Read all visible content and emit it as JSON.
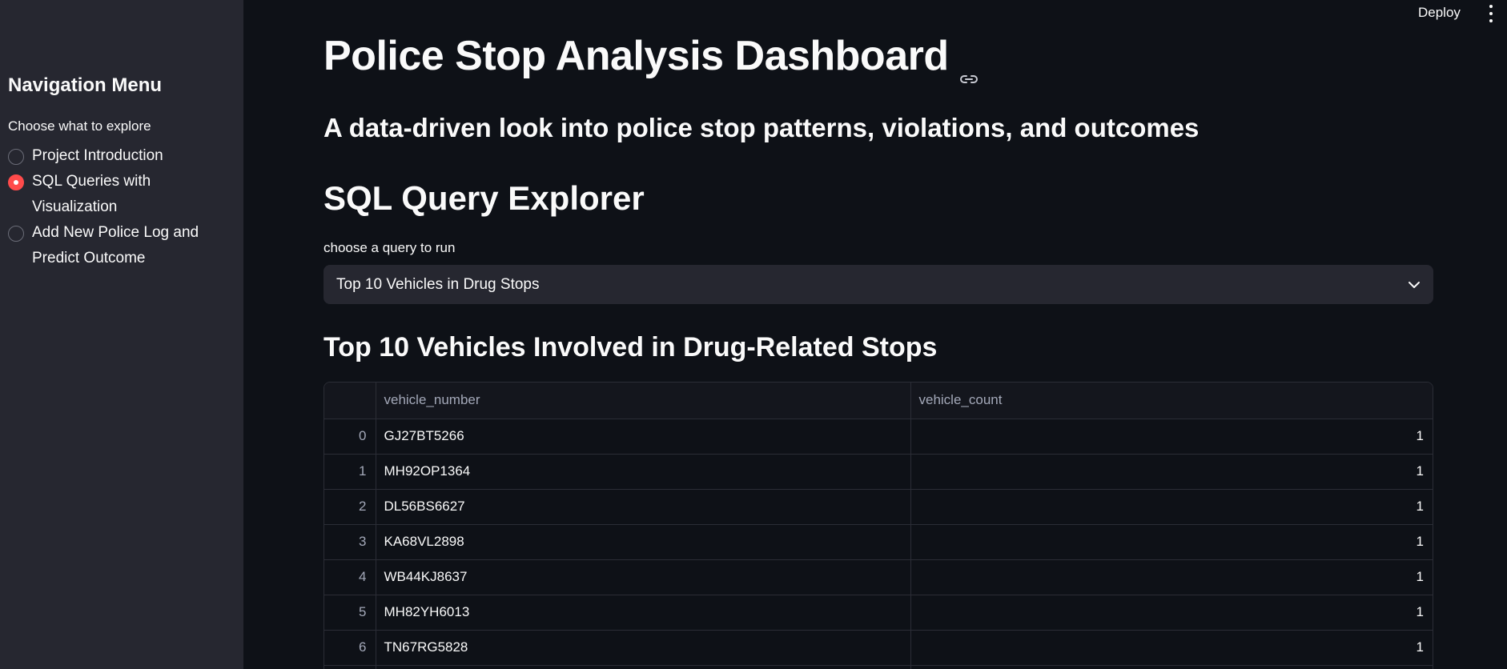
{
  "sidebar": {
    "title": "Navigation Menu",
    "caption": "Choose what to explore",
    "items": [
      {
        "label": "Project Introduction",
        "selected": false
      },
      {
        "label": "SQL Queries with Visualization",
        "selected": true
      },
      {
        "label": "Add New Police Log and Predict Outcome",
        "selected": false
      }
    ]
  },
  "header": {
    "deploy_label": "Deploy"
  },
  "main": {
    "title": "Police Stop Analysis Dashboard",
    "subtitle": "A data-driven look into police stop patterns, violations, and outcomes",
    "section_title": "SQL Query Explorer",
    "select_label": "choose a query to run",
    "select_value": "Top 10 Vehicles in Drug Stops",
    "table_title": "Top 10 Vehicles Involved in Drug-Related Stops"
  },
  "table": {
    "columns": [
      "",
      "vehicle_number",
      "vehicle_count"
    ],
    "rows": [
      {
        "index": "0",
        "vehicle_number": "GJ27BT5266",
        "vehicle_count": "1"
      },
      {
        "index": "1",
        "vehicle_number": "MH92OP1364",
        "vehicle_count": "1"
      },
      {
        "index": "2",
        "vehicle_number": "DL56BS6627",
        "vehicle_count": "1"
      },
      {
        "index": "3",
        "vehicle_number": "KA68VL2898",
        "vehicle_count": "1"
      },
      {
        "index": "4",
        "vehicle_number": "WB44KJ8637",
        "vehicle_count": "1"
      },
      {
        "index": "5",
        "vehicle_number": "MH82YH6013",
        "vehicle_count": "1"
      },
      {
        "index": "6",
        "vehicle_number": "TN67RG5828",
        "vehicle_count": "1"
      },
      {
        "index": "7",
        "vehicle_number": "",
        "vehicle_count": ""
      }
    ]
  },
  "colors": {
    "accent": "#ff4b4b",
    "background": "#0e1117",
    "sidebar": "#262730"
  }
}
